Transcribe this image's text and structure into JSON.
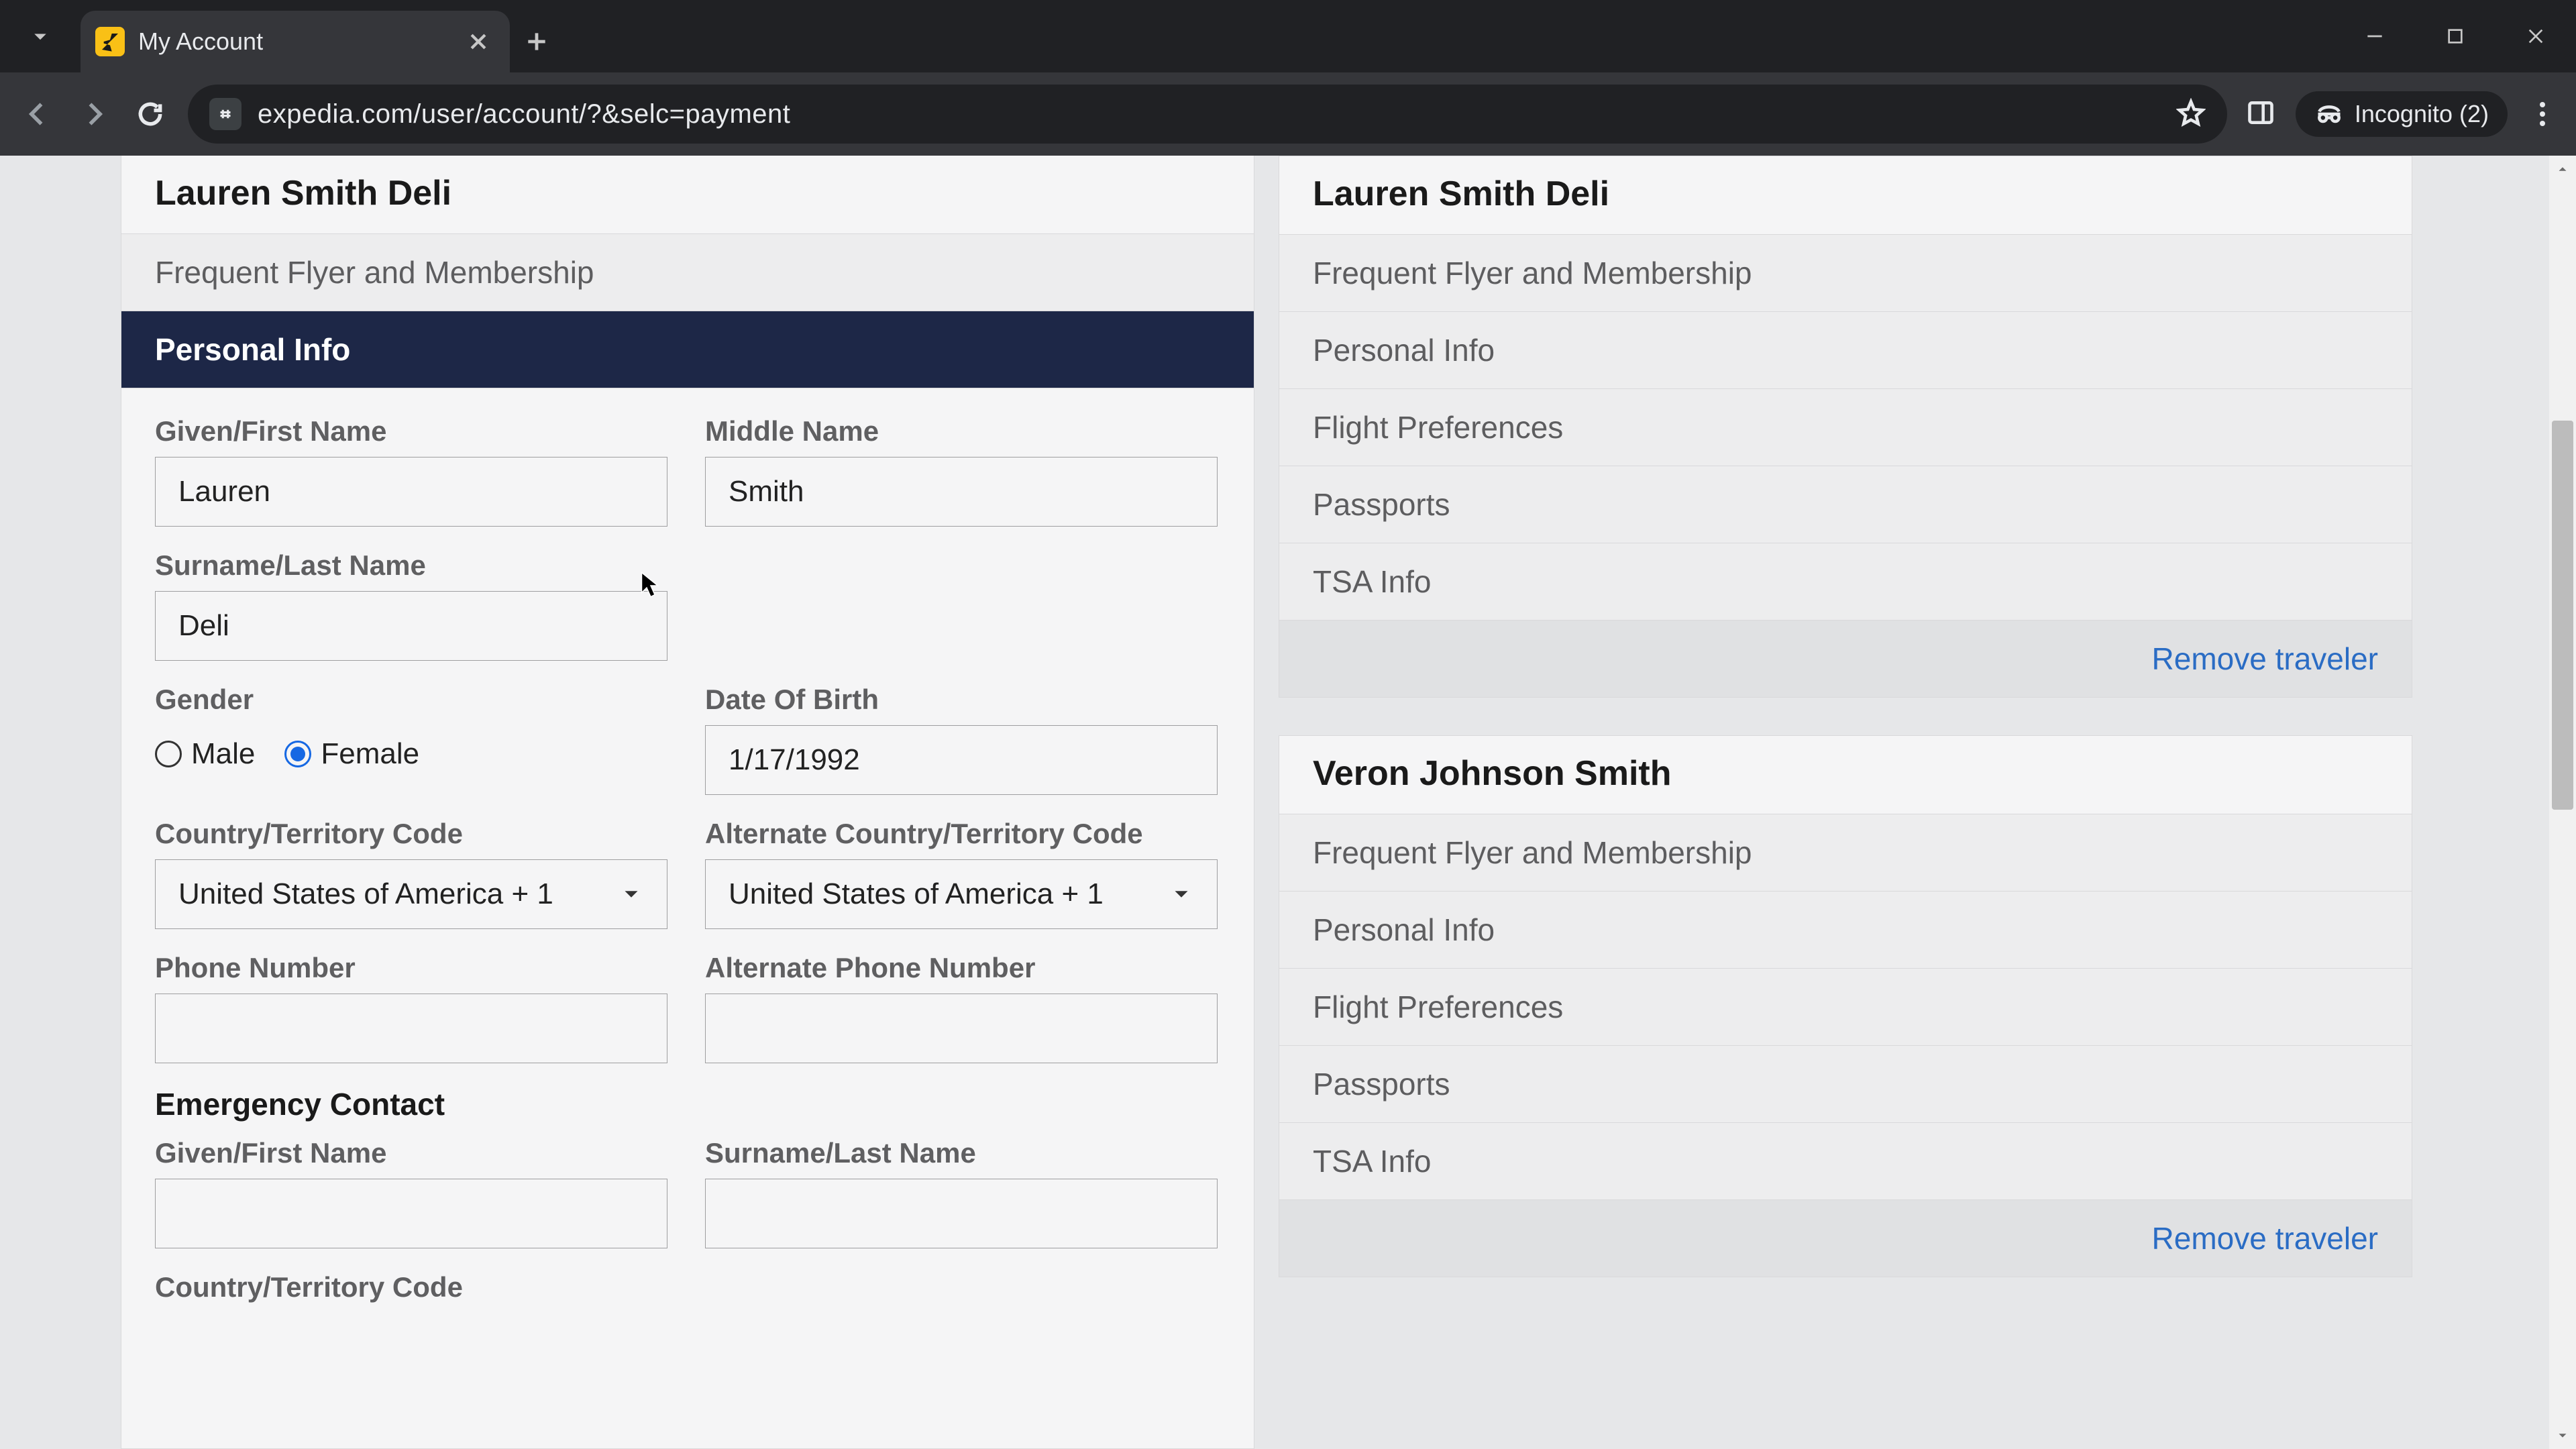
{
  "browser": {
    "tab_title": "My Account",
    "url": "expedia.com/user/account/?&selc=payment",
    "incognito_label": "Incognito (2)"
  },
  "left_panel": {
    "traveler_name": "Lauren Smith Deli",
    "section_above": "Frequent Flyer and Membership",
    "active_section": "Personal Info"
  },
  "form": {
    "labels": {
      "first": "Given/First Name",
      "middle": "Middle Name",
      "last": "Surname/Last Name",
      "gender": "Gender",
      "dob": "Date Of Birth",
      "country": "Country/Territory Code",
      "alt_country": "Alternate Country/Territory Code",
      "phone": "Phone Number",
      "alt_phone": "Alternate Phone Number",
      "emergency_header": "Emergency Contact",
      "em_first": "Given/First Name",
      "em_last": "Surname/Last Name",
      "em_country": "Country/Territory Code"
    },
    "values": {
      "first": "Lauren",
      "middle": "Smith",
      "last": "Deli",
      "gender_male": "Male",
      "gender_female": "Female",
      "dob": "1/17/1992",
      "country": "United States of America + 1",
      "alt_country": "United States of America + 1",
      "phone": "",
      "alt_phone": "",
      "em_first": "",
      "em_last": ""
    }
  },
  "right_panel": {
    "travelers": [
      {
        "name": "Lauren Smith Deli",
        "sections": [
          "Frequent Flyer and Membership",
          "Personal Info",
          "Flight Preferences",
          "Passports",
          "TSA Info"
        ],
        "remove_label": "Remove traveler"
      },
      {
        "name": "Veron Johnson Smith",
        "sections": [
          "Frequent Flyer and Membership",
          "Personal Info",
          "Flight Preferences",
          "Passports",
          "TSA Info"
        ],
        "remove_label": "Remove traveler"
      }
    ]
  }
}
